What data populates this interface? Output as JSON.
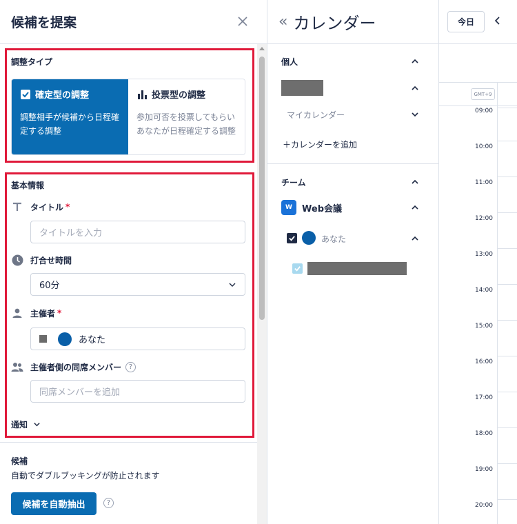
{
  "left_panel": {
    "title": "候補を提案",
    "type_section": {
      "label": "調整タイプ",
      "fixed": {
        "title": "確定型の調整",
        "desc": "調整相手が候補から日程確定する調整"
      },
      "vote": {
        "title": "投票型の調整",
        "desc": "参加可否を投票してもらいあなたが日程確定する調整"
      }
    },
    "info_section": {
      "label": "基本情報",
      "title_field": {
        "label": "タイトル",
        "required": "*",
        "placeholder": "タイトルを入力"
      },
      "duration_field": {
        "label": "打合せ時間",
        "value": "60分"
      },
      "organizer_field": {
        "label": "主催者",
        "required": "*",
        "value": "あなた"
      },
      "members_field": {
        "label": "主催者側の同席メンバー",
        "help": "?",
        "placeholder": "同席メンバーを追加"
      },
      "notify_label": "通知"
    },
    "candidates": {
      "title": "候補",
      "desc": "自動でダブルブッキングが防止されます",
      "button": "候補を自動抽出",
      "help": "?"
    }
  },
  "calendar_panel": {
    "collapse_icon": "«",
    "title": "カレンダー",
    "personal_label": "個人",
    "my_calendar": "マイカレンダー",
    "add_calendar": "＋カレンダーを追加",
    "team_label": "チーム",
    "web_badge": "W",
    "web_label": "Web会議",
    "you_label": "あなた"
  },
  "schedule_panel": {
    "today_button": "今日",
    "timezone": "GMT+9",
    "hours": [
      "09:00",
      "10:00",
      "11:00",
      "12:00",
      "13:00",
      "14:00",
      "15:00",
      "16:00",
      "17:00",
      "18:00",
      "19:00",
      "20:00"
    ]
  },
  "colors": {
    "accent": "#0a6cb2",
    "highlight_border": "#e0193a",
    "text": "#1f2a44"
  }
}
